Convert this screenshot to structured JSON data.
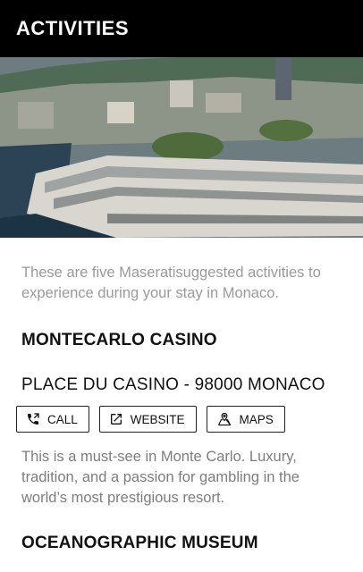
{
  "header": {
    "title": "ACTIVITIES"
  },
  "hero": {
    "image": "monaco-harbor-photo"
  },
  "intro": "These are five Maseratisuggested activities to experience during your stay in Monaco.",
  "activities": [
    {
      "title": "MONTECARLO CASINO",
      "address": "PLACE DU CASINO - 98000 MONACO",
      "actions": {
        "call": "CALL",
        "website": "WEBSITE",
        "maps": "MAPS"
      },
      "description": "This is a must-see in Monte Carlo. Luxury, tradition, and a passion for gambling in the world’s most prestigious resort."
    },
    {
      "title": "OCEANOGRAPHIC MUSEUM"
    }
  ],
  "icons": {
    "call": "phone-icon",
    "website": "external-link-icon",
    "maps": "map-icon"
  }
}
